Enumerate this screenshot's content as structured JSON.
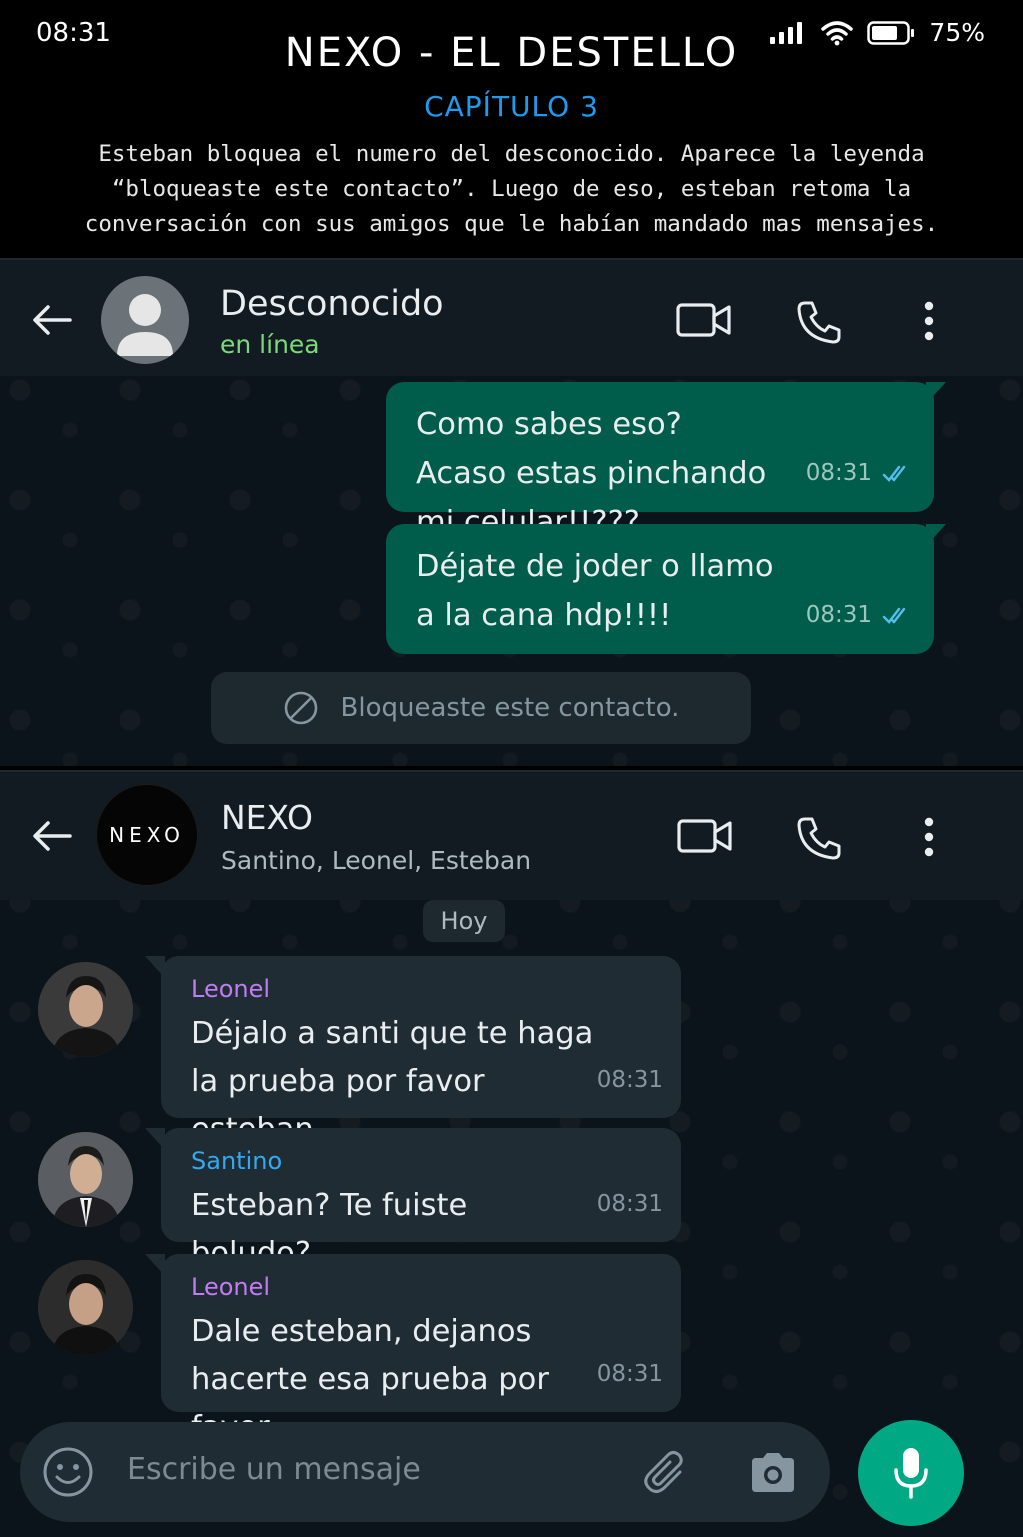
{
  "status_bar": {
    "time": "08:31",
    "battery": "75%"
  },
  "story": {
    "title": "NEXO - EL DESTELLO",
    "chapter": "CAPÍTULO 3",
    "synopsis": "Esteban bloquea el numero del desconocido. Aparece la leyenda “bloqueaste este contacto”. Luego de eso, esteban retoma la conversación con sus amigos que le habían mandado mas mensajes."
  },
  "chat1": {
    "contact_name": "Desconocido",
    "status": "en línea",
    "messages": [
      {
        "text": "Como sabes eso? Acaso estas pinchando mi celular!!???",
        "time": "08:31"
      },
      {
        "text": "Déjate de joder o llamo a la cana hdp!!!!",
        "time": "08:31"
      }
    ],
    "system_note": "Bloqueaste este contacto."
  },
  "chat2": {
    "group_name": "NEXO",
    "avatar_text": "NEXO",
    "members": "Santino, Leonel, Esteban",
    "date_chip": "Hoy",
    "messages": [
      {
        "sender": "Leonel",
        "sender_color": "#c07cf2",
        "text": "Déjalo a santi que te haga la prueba por favor esteban",
        "time": "08:31"
      },
      {
        "sender": "Santino",
        "sender_color": "#34a8f0",
        "text": "Esteban? Te fuiste boludo?",
        "time": "08:31"
      },
      {
        "sender": "Leonel",
        "sender_color": "#c07cf2",
        "text": "Dale esteban, dejanos hacerte esa prueba por favor",
        "time": "08:31"
      }
    ],
    "composer_placeholder": "Escribe un mensaje"
  },
  "colors": {
    "outgoing_bubble": "#005c4b",
    "incoming_bubble": "#202c33",
    "chat_background": "#0b141a",
    "accent": "#00a884",
    "chapter": "#1e9bf0",
    "online": "#7bd87b"
  },
  "icons": [
    "back-arrow-icon",
    "video-call-icon",
    "phone-icon",
    "more-vert-icon",
    "block-icon",
    "double-check-icon",
    "emoji-icon",
    "attach-icon",
    "camera-icon",
    "mic-icon",
    "signal-icon",
    "wifi-icon",
    "battery-icon"
  ]
}
